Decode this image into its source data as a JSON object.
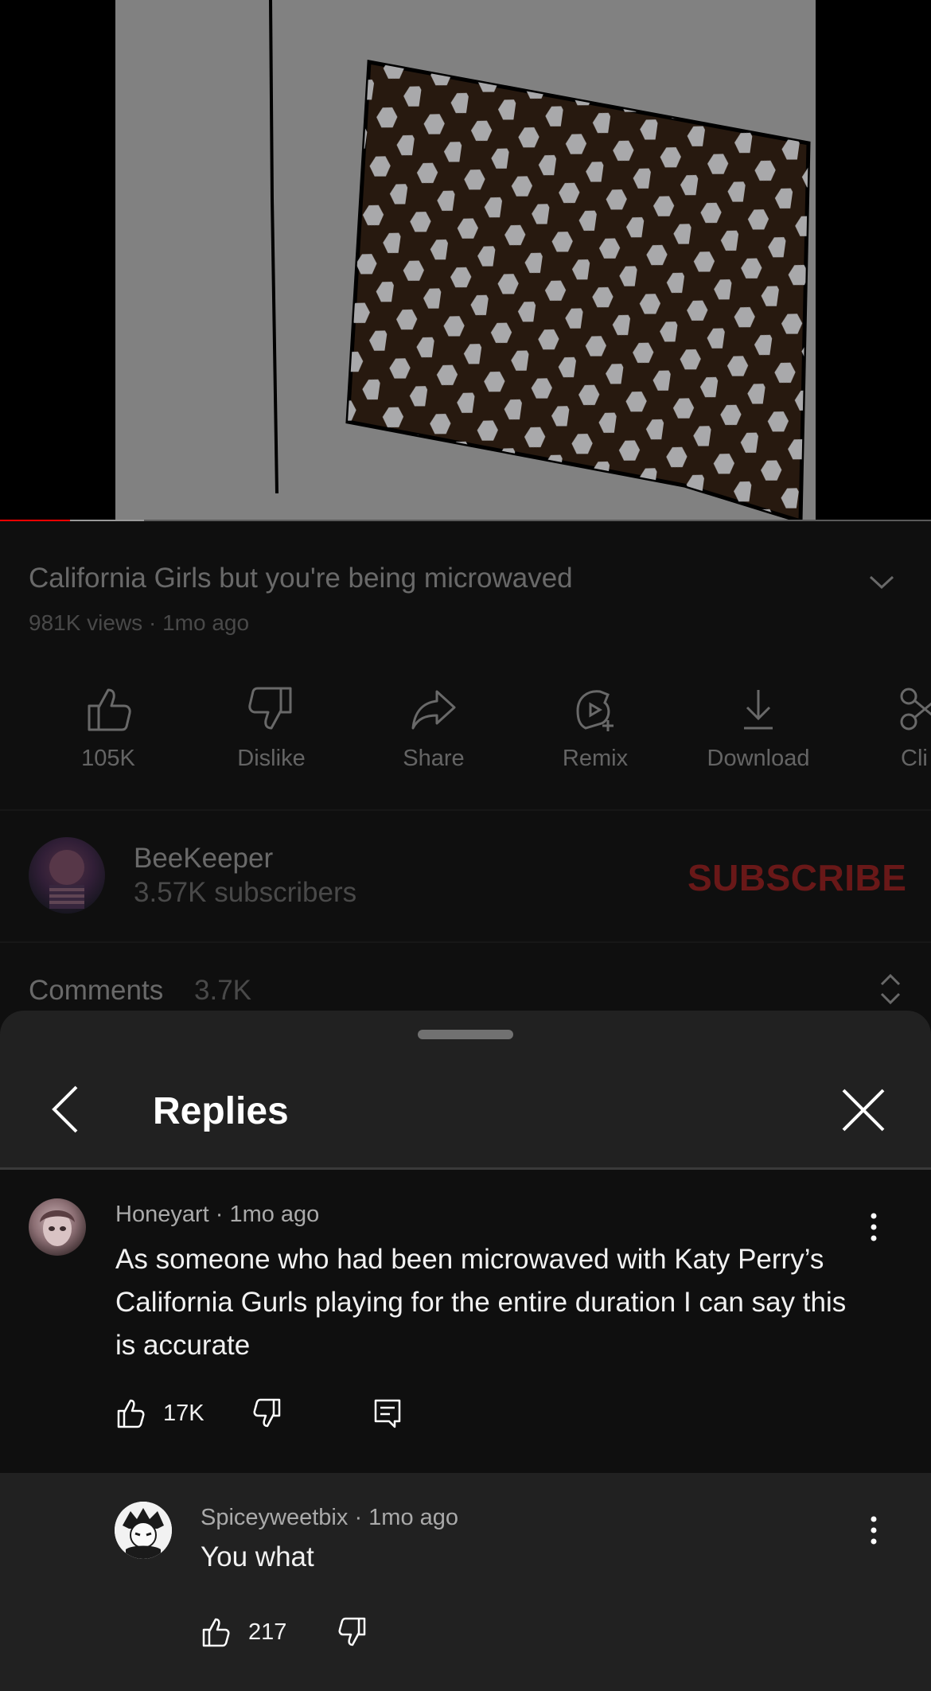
{
  "video": {
    "progress_played": 0.075,
    "progress_buffered": 0.155
  },
  "video_info": {
    "title": "California Girls but you're being microwaved",
    "meta": "981K views · 1mo ago"
  },
  "actions": [
    {
      "label": "105K",
      "icon": "like-icon"
    },
    {
      "label": "Dislike",
      "icon": "dislike-icon"
    },
    {
      "label": "Share",
      "icon": "share-icon"
    },
    {
      "label": "Remix",
      "icon": "remix-icon"
    },
    {
      "label": "Download",
      "icon": "download-icon"
    },
    {
      "label": "Cli",
      "icon": "clip-icon"
    }
  ],
  "channel": {
    "name": "BeeKeeper",
    "subscribers": "3.57K subscribers",
    "subscribe_label": "SUBSCRIBE"
  },
  "comments": {
    "label": "Comments",
    "count": "3.7K"
  },
  "replies_sheet": {
    "title": "Replies",
    "parent_comment": {
      "author": "Honeyart",
      "time": "1mo ago",
      "text": "As someone who had been microwaved with Katy Perry’s California Gurls playing for the entire duration I can say this is accurate",
      "likes": "17K"
    },
    "reply": {
      "author": "Spiceyweetbix",
      "time": "1mo ago",
      "text": "You what",
      "likes": "217"
    }
  },
  "colors": {
    "accent_red": "#ff0000",
    "background": "#0f0f0f",
    "sheet": "#212121"
  }
}
